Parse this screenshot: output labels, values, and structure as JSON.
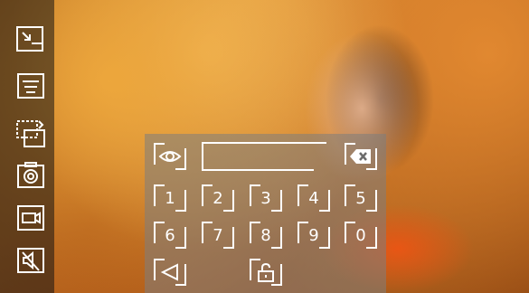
{
  "sidebar": {
    "icons": [
      "exit-fullscreen-icon",
      "menu-icon",
      "swap-camera-icon",
      "snapshot-icon",
      "video-record-icon",
      "mute-icon"
    ]
  },
  "keypad": {
    "password_value": "",
    "digits_row1": [
      "1",
      "2",
      "3",
      "4",
      "5"
    ],
    "digits_row2": [
      "6",
      "7",
      "8",
      "9",
      "0"
    ],
    "icons": {
      "show_password": "eye-icon",
      "backspace": "backspace-icon",
      "back": "back-arrow-icon",
      "unlock": "unlock-icon"
    }
  }
}
